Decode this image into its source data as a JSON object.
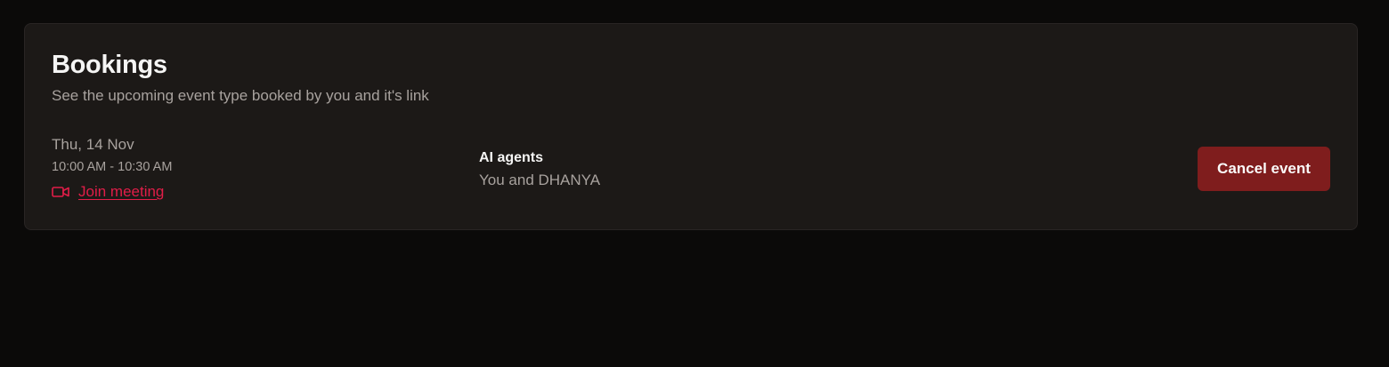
{
  "bookings": {
    "title": "Bookings",
    "subtitle": "See the upcoming event type booked by you and it's link",
    "items": [
      {
        "date": "Thu, 14 Nov",
        "time": "10:00 AM - 10:30 AM",
        "join_label": "Join meeting",
        "join_icon": "video-camera-icon",
        "event_name": "AI agents",
        "attendees": "You and DHANYA",
        "cancel_label": "Cancel event"
      }
    ]
  },
  "colors": {
    "page_background": "#0b0a09",
    "card_background": "#1c1917",
    "card_border": "#292524",
    "link_accent": "#e11d48",
    "danger_button": "#7f1d1d",
    "primary_text": "#f5f5f4",
    "secondary_text": "#a8a29e"
  }
}
